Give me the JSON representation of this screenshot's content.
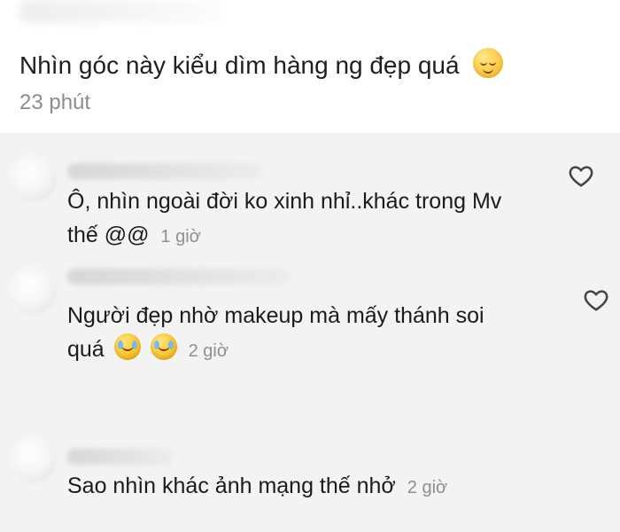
{
  "post": {
    "text": "Nhìn góc này kiểu dìm hàng ng đẹp quá",
    "emoji_name": "relieved-face-icon",
    "time": "23 phút"
  },
  "comments": [
    {
      "line1": "Ô, nhìn ngoài đời ko xinh nhỉ..khác trong Mv",
      "line2": "thế @@",
      "time": "1 giờ",
      "has_like_icon": true
    },
    {
      "line1": "Người đẹp nhờ makeup mà mấy thánh soi",
      "line2": "quá",
      "time": "2 giờ",
      "emoji_name": "laughing-face-icon",
      "has_like_icon": true
    },
    {
      "line1": "Sao nhìn khác ảnh mạng thế nhở",
      "time": "2 giờ",
      "has_like_icon": false
    }
  ],
  "colors": {
    "background": "#ffffff",
    "comment_background": "#f3f3f3",
    "text": "#1b1b1b",
    "muted": "#8f8f8f"
  }
}
